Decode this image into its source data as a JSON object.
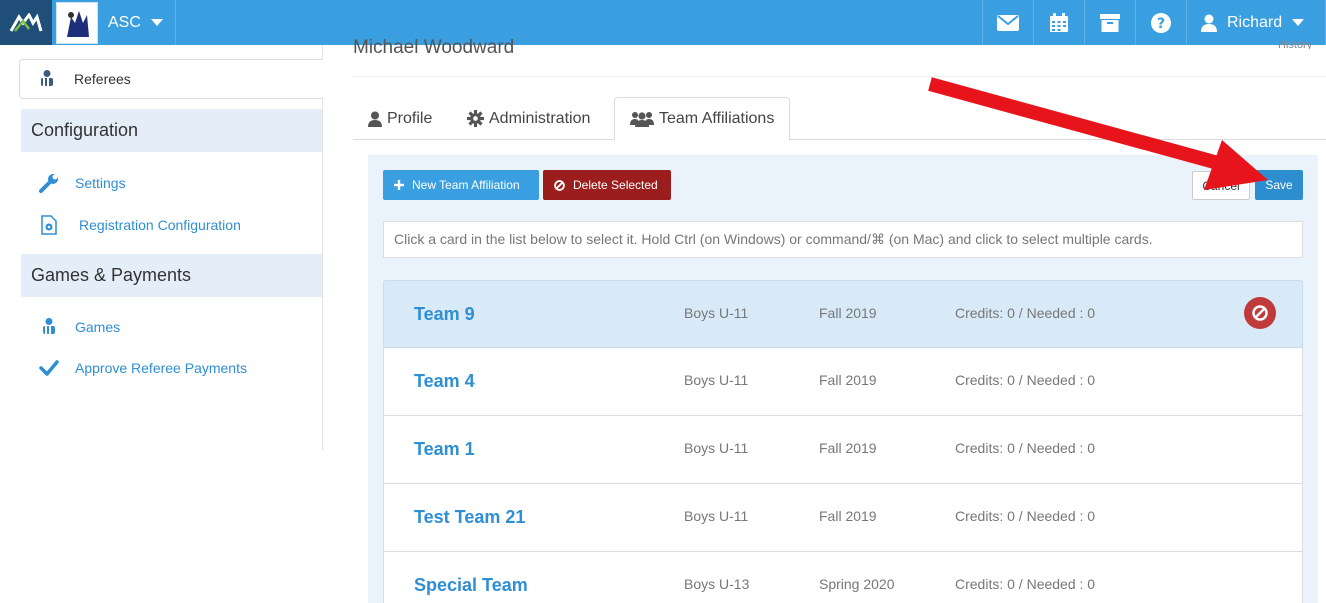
{
  "header": {
    "org_name": "ASC",
    "user_name": "Richard",
    "icons": [
      "mail-icon",
      "calendar-icon",
      "archive-icon",
      "help-icon",
      "user-icon"
    ]
  },
  "sidebar": {
    "active_item": "Referees",
    "sections": [
      {
        "title": "Configuration",
        "items": [
          {
            "label": "Settings",
            "icon": "wrench-icon"
          },
          {
            "label": "Registration Configuration",
            "icon": "settings-document-icon"
          }
        ]
      },
      {
        "title": "Games & Payments",
        "items": [
          {
            "label": "Games",
            "icon": "referee-icon"
          },
          {
            "label": "Approve Referee Payments",
            "icon": "checkmark-icon"
          }
        ]
      }
    ]
  },
  "main": {
    "title": "Michael Woodward",
    "history_link": "History",
    "tabs": [
      {
        "label": "Profile",
        "icon": "user-icon"
      },
      {
        "label": "Administration",
        "icon": "gear-icon"
      },
      {
        "label": "Team Affiliations",
        "icon": "users-icon",
        "active": true
      }
    ],
    "toolbar": {
      "new_label": "New Team Affiliation",
      "delete_label": "Delete Selected",
      "cancel_label": "Cancel",
      "save_label": "Save"
    },
    "hint": "Click a card in the list below to select it. Hold Ctrl (on Windows) or command/⌘ (on Mac) and click to select multiple cards.",
    "cards": [
      {
        "name": "Team 9",
        "division": "Boys U-11",
        "season": "Fall 2019",
        "credits": "Credits: 0 / Needed : 0",
        "selected": true
      },
      {
        "name": "Team 4",
        "division": "Boys U-11",
        "season": "Fall 2019",
        "credits": "Credits: 0 / Needed : 0"
      },
      {
        "name": "Team 1",
        "division": "Boys U-11",
        "season": "Fall 2019",
        "credits": "Credits: 0 / Needed : 0"
      },
      {
        "name": "Test Team 21",
        "division": "Boys U-11",
        "season": "Fall 2019",
        "credits": "Credits: 0 / Needed : 0"
      },
      {
        "name": "Special Team",
        "division": "Boys U-13",
        "season": "Spring 2020",
        "credits": "Credits: 0 / Needed : 0"
      }
    ]
  },
  "colors": {
    "topbar": "#3a9fe0",
    "link": "#2f8ed4",
    "delete": "#9b1d1d",
    "save": "#2c8ecf",
    "arrow": "#e8141b"
  }
}
